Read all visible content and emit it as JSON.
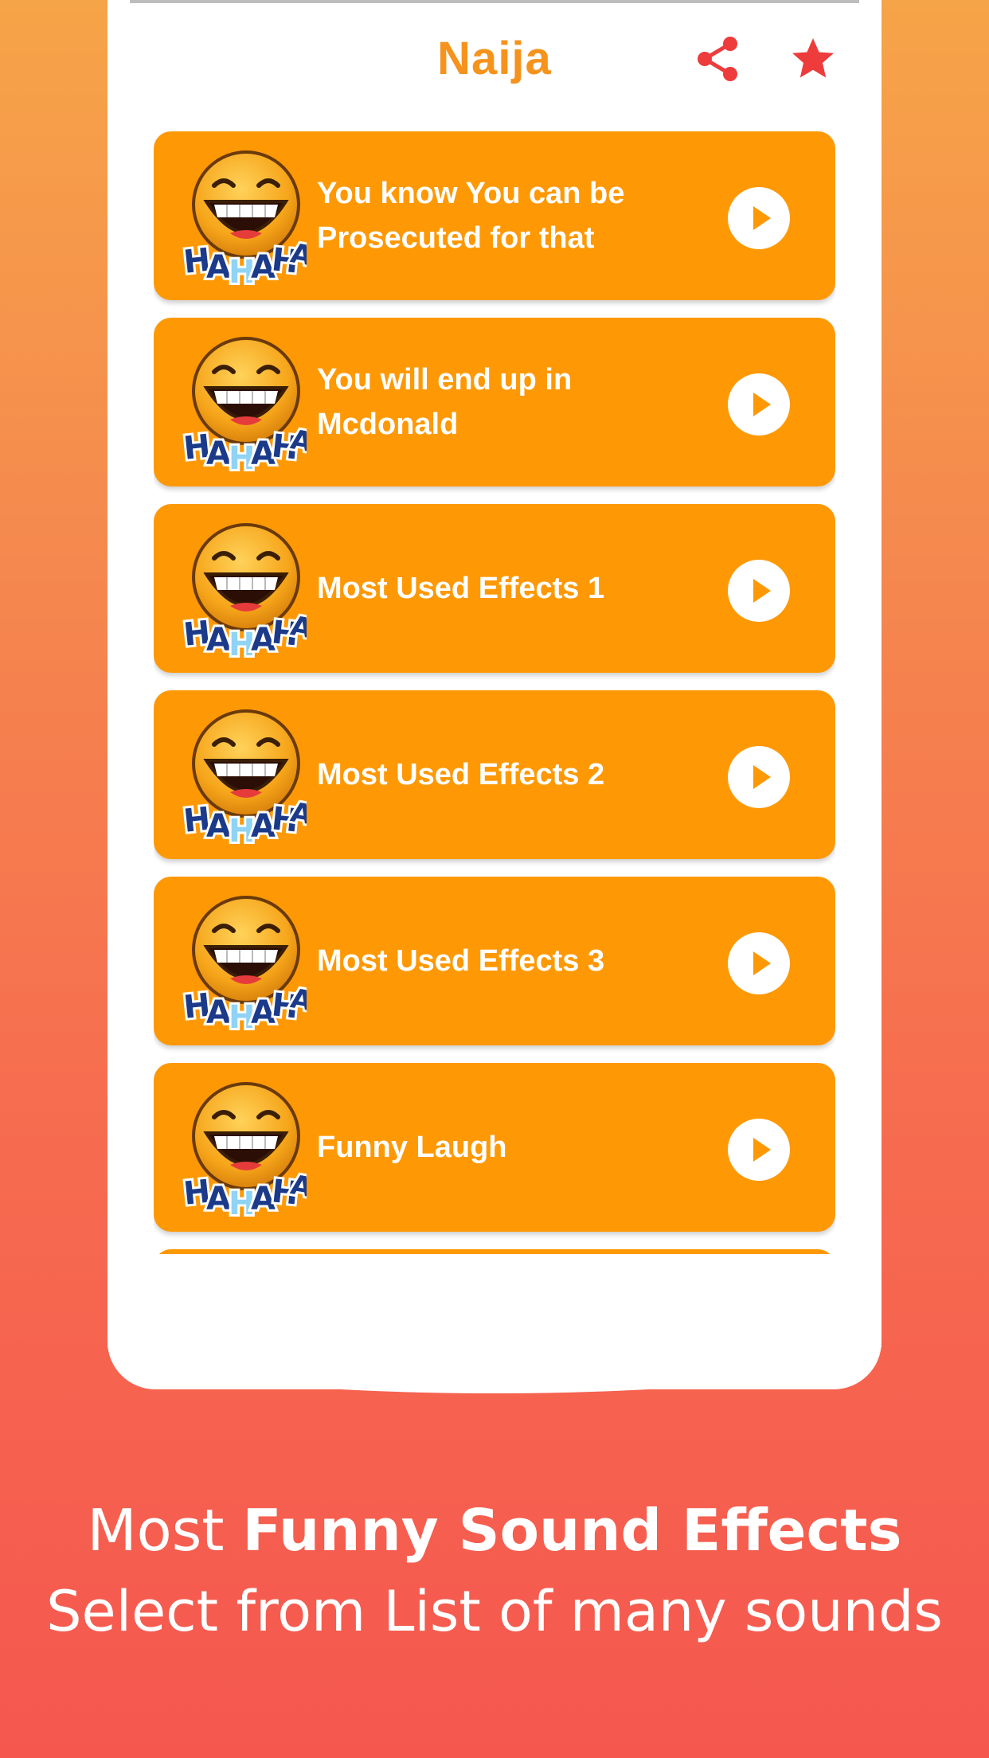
{
  "header": {
    "title": "Naija",
    "share_icon": "share-icon",
    "favorite_icon": "star-icon",
    "accent_color": "#f6931d",
    "favorite_color": "#ee3b3b"
  },
  "sounds": [
    {
      "label": "You know You can be Prosecuted for that",
      "icon": "hahaha-emoji-icon",
      "action": "play-icon"
    },
    {
      "label": "You will end up in Mcdonald",
      "icon": "hahaha-emoji-icon",
      "action": "play-icon"
    },
    {
      "label": "Most Used Effects 1",
      "icon": "hahaha-emoji-icon",
      "action": "play-icon"
    },
    {
      "label": "Most Used Effects 2",
      "icon": "hahaha-emoji-icon",
      "action": "play-icon"
    },
    {
      "label": "Most Used Effects 3",
      "icon": "hahaha-emoji-icon",
      "action": "play-icon"
    },
    {
      "label": "Funny Laugh",
      "icon": "hahaha-emoji-icon",
      "action": "play-icon"
    }
  ],
  "item_color": "#fe9905",
  "caption": {
    "line1_prefix": "Most ",
    "line1_bold": "Funny Sound Effects",
    "line2": "Select from List of many sounds"
  }
}
